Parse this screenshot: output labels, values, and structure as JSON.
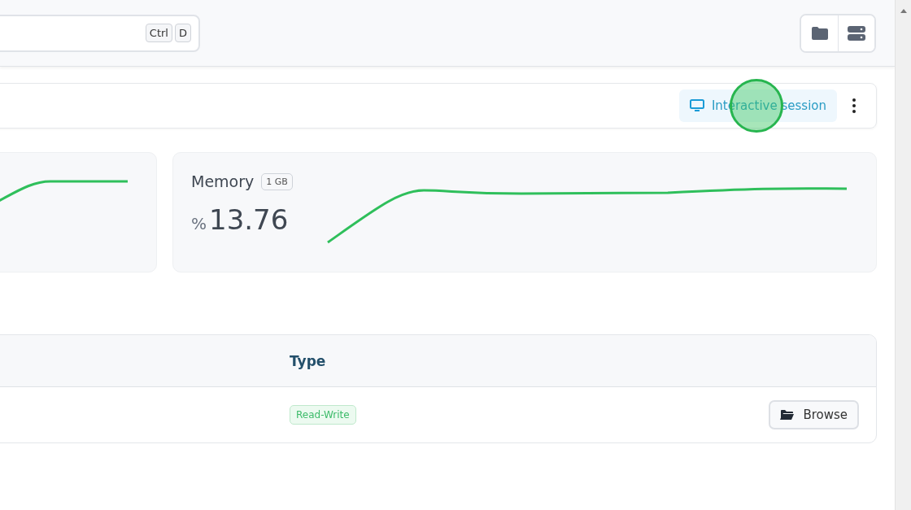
{
  "header": {
    "search": {
      "shortcut_keys": [
        "Ctrl",
        "D"
      ]
    }
  },
  "session_bar": {
    "button": "Interactive session"
  },
  "metrics": [
    {
      "kind": "partial"
    },
    {
      "kind": "full",
      "title": "Memory",
      "badge": "1 GB",
      "unit": "%",
      "value": "13.76"
    }
  ],
  "table": {
    "columns": [
      "Type"
    ],
    "rows": [
      {
        "type": "Read-Write",
        "action": "Browse"
      }
    ]
  },
  "click_indicator": {
    "visible": true
  }
}
